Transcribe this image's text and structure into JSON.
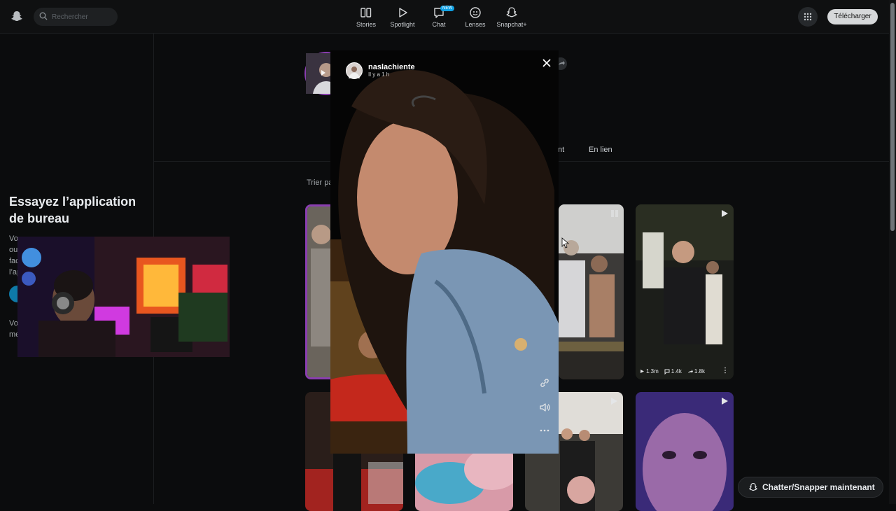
{
  "topbar": {
    "search_placeholder": "Rechercher",
    "nav": [
      {
        "label": "Stories",
        "icon": "stories-icon"
      },
      {
        "label": "Spotlight",
        "icon": "play-icon"
      },
      {
        "label": "Chat",
        "icon": "chat-icon",
        "badge": "NEW"
      },
      {
        "label": "Lenses",
        "icon": "lenses-icon"
      },
      {
        "label": "Snapchat+",
        "icon": "ghost-plus-icon"
      }
    ],
    "download_label": "Télécharger"
  },
  "sidebar": {
    "title": "Essayez l’application de bureau",
    "text_lines": [
      "Vo",
      "ou",
      "fac",
      "l’ap"
    ],
    "text2_lines": [
      "Vo",
      "me"
    ]
  },
  "profile": {
    "tab_partial": "nt",
    "tab_links": "En lien",
    "sort_label_partial": "Trier pa"
  },
  "story": {
    "username": "naslachiente",
    "time_ago": "Il y a 1 h"
  },
  "thumbnails": {
    "stats": {
      "views": "1.3m",
      "comments": "1.4k",
      "shares": "1.8k"
    }
  },
  "chat_cta": {
    "label": "Chatter/Snapper maintenant"
  },
  "colors": {
    "background": "#0b0c0d",
    "accent_blue": "#0fa2e6",
    "story_ring": "#8a3eb0"
  }
}
